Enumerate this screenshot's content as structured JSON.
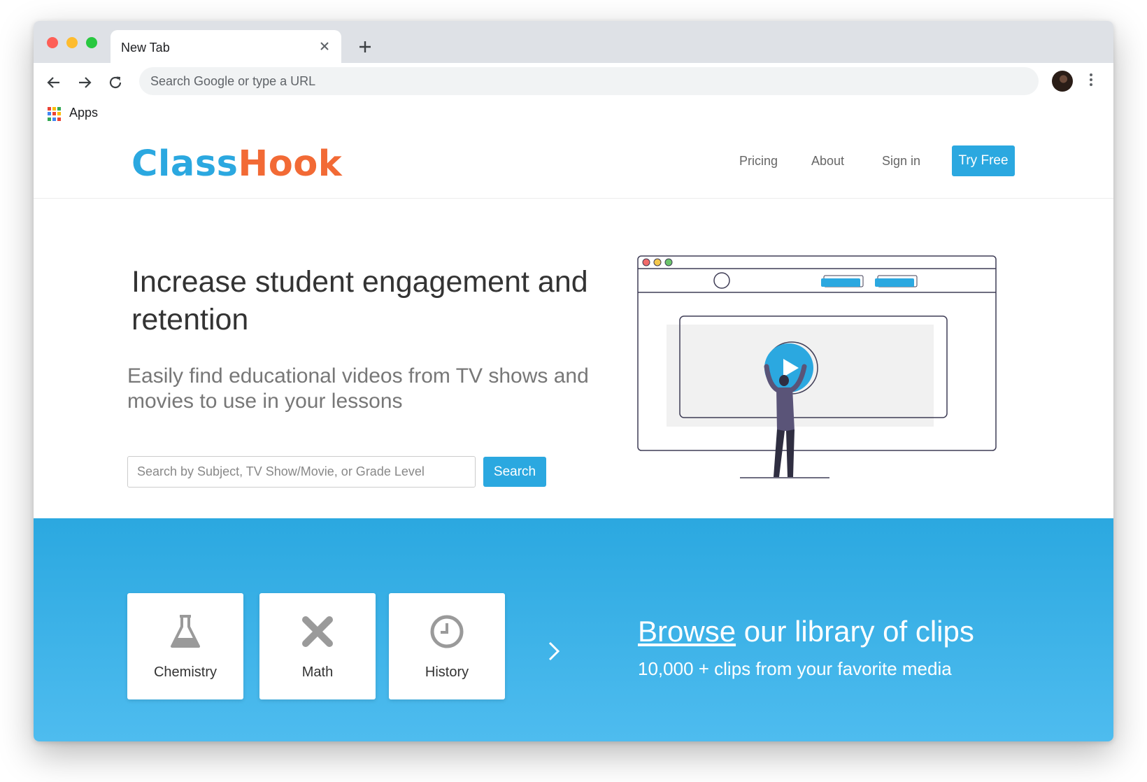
{
  "browser": {
    "tab_title": "New Tab",
    "omnibox_placeholder": "Search Google or type a URL",
    "bookmarks": [
      {
        "label": "Apps",
        "icon": "apps-grid-icon"
      }
    ]
  },
  "site": {
    "logo": {
      "part1": "Class",
      "part2": "Hook",
      "color1": "#2ba8e0",
      "color2": "#f26a35"
    },
    "nav": {
      "pricing": "Pricing",
      "about": "About",
      "signin": "Sign in",
      "cta": "Try Free"
    },
    "hero": {
      "title": "Increase student engagement and retention",
      "subtitle": "Easily find educational videos from TV shows and movies to use in your lessons",
      "search_placeholder": "Search by Subject, TV Show/Movie, or Grade Level",
      "search_button": "Search"
    },
    "categories": [
      {
        "label": "Chemistry",
        "icon": "flask-icon"
      },
      {
        "label": "Math",
        "icon": "x-icon"
      },
      {
        "label": "History",
        "icon": "clock-icon"
      }
    ],
    "browse": {
      "link_text": "Browse",
      "title_rest": " our library of clips",
      "subtitle": "10,000 + clips from your favorite media"
    },
    "accent_color": "#2ba8e0"
  }
}
